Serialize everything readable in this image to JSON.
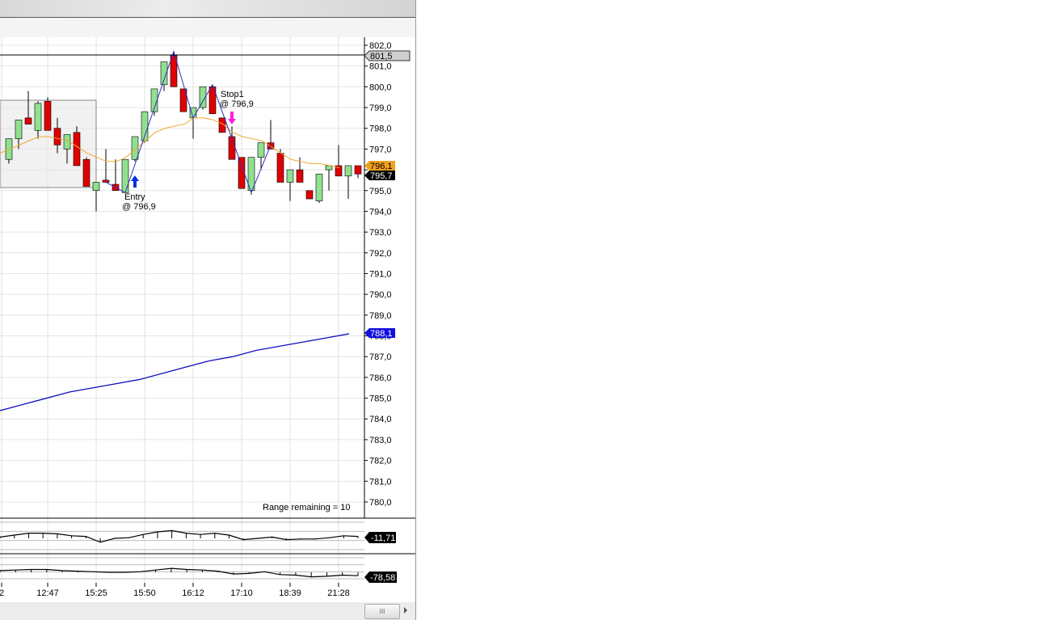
{
  "price_axis": {
    "labels": [
      "802,0",
      "801,0",
      "800,0",
      "799,0",
      "798,0",
      "797,0",
      "796,0",
      "795,0",
      "794,0",
      "793,0",
      "792,0",
      "791,0",
      "790,0",
      "789,0",
      "788,0",
      "787,0",
      "786,0",
      "785,0",
      "784,0",
      "783,0",
      "782,0",
      "781,0",
      "780,0"
    ],
    "max": 802,
    "min": 780
  },
  "time_axis": {
    "labels": [
      "2",
      "12:47",
      "15:25",
      "15:50",
      "16:12",
      "17:10",
      "18:39",
      "21:28"
    ]
  },
  "markers": {
    "high_line": "801,5",
    "ma_value": "796,1",
    "last_price": "795,7",
    "long_ma_value": "788,1",
    "high_price": 801.5,
    "ma_price": 796.1,
    "last": 795.7,
    "long_ma": 788.1
  },
  "annotations": {
    "entry_label": "Entry",
    "entry_price": "@ 796,9",
    "stop_label": "Stop1",
    "stop_price": "@ 796,9",
    "range_text": "Range remaining = 10"
  },
  "indicators": {
    "ind1_value": "-11,71",
    "ind2_value": "-78,58"
  },
  "scrollbar": {
    "thumb_label": "III"
  },
  "colors": {
    "up": "#90e090",
    "down": "#e00000",
    "ma": "#f0a830",
    "long_ma": "#1010c0",
    "zigzag": "#3030c0",
    "entry": "#0030e0",
    "stop": "#ff20e0"
  },
  "candles": [
    [
      796.5,
      797.5,
      796.3,
      797.5
    ],
    [
      797.5,
      798.0,
      797.0,
      798.4
    ],
    [
      798.5,
      799.8,
      798.2,
      798.2
    ],
    [
      797.9,
      799.3,
      797.5,
      799.2
    ],
    [
      799.3,
      799.5,
      797.9,
      797.9
    ],
    [
      798.0,
      798.5,
      796.8,
      797.2
    ],
    [
      797.0,
      797.7,
      796.3,
      797.7
    ],
    [
      797.8,
      798.1,
      796.2,
      796.2
    ],
    [
      796.5,
      796.6,
      795.2,
      795.2
    ],
    [
      795.0,
      795.4,
      794.0,
      795.4
    ],
    [
      795.5,
      797.0,
      795.4,
      795.4
    ],
    [
      795.3,
      796.5,
      795.0,
      795.0
    ],
    [
      794.9,
      796.5,
      794.9,
      796.5
    ],
    [
      796.5,
      797.6,
      796.4,
      797.6
    ],
    [
      797.4,
      798.8,
      797.3,
      798.8
    ],
    [
      798.8,
      799.9,
      798.6,
      799.9
    ],
    [
      800.1,
      801.2,
      799.8,
      801.2
    ],
    [
      801.5,
      801.7,
      800.0,
      800.0
    ],
    [
      799.9,
      799.9,
      798.8,
      798.8
    ],
    [
      798.5,
      799.0,
      797.5,
      799.0
    ],
    [
      799.0,
      800.0,
      798.9,
      800.0
    ],
    [
      800.0,
      800.1,
      798.7,
      798.7
    ],
    [
      798.5,
      798.5,
      797.8,
      797.8
    ],
    [
      797.6,
      798.1,
      796.5,
      796.5
    ],
    [
      796.6,
      796.6,
      795.1,
      795.1
    ],
    [
      795.0,
      796.6,
      794.8,
      796.6
    ],
    [
      796.6,
      797.3,
      796.0,
      797.3
    ],
    [
      797.3,
      798.4,
      797.0,
      797.0
    ],
    [
      796.8,
      797.0,
      795.4,
      795.4
    ],
    [
      795.4,
      796.0,
      794.5,
      796.0
    ],
    [
      796.0,
      796.6,
      795.4,
      795.4
    ],
    [
      795.0,
      795.0,
      794.6,
      794.6
    ],
    [
      794.5,
      795.8,
      794.4,
      795.8
    ],
    [
      796.0,
      796.2,
      795.0,
      796.2
    ],
    [
      796.2,
      797.2,
      795.7,
      795.7
    ],
    [
      795.7,
      796.2,
      794.6,
      796.2
    ],
    [
      796.2,
      796.2,
      795.6,
      795.8
    ]
  ],
  "ma_series": [
    796.8,
    797.0,
    797.2,
    797.4,
    797.6,
    797.6,
    797.5,
    797.4,
    797.1,
    796.8,
    796.6,
    796.4,
    796.4,
    796.6,
    797.0,
    797.4,
    797.8,
    798.0,
    798.1,
    798.2,
    798.5,
    798.5,
    798.4,
    798.2,
    797.8,
    797.6,
    797.5,
    797.4,
    797.1,
    796.8,
    796.5,
    796.4,
    796.3,
    796.3,
    796.2,
    796.1
  ],
  "long_ma_series": [
    784.4,
    784.7,
    785.0,
    785.3,
    785.5,
    785.7,
    785.9,
    786.2,
    786.5,
    786.8,
    787.0,
    787.3,
    787.5,
    787.7,
    787.9,
    788.1
  ],
  "ind1_series": [
    0.2,
    0.5,
    0.8,
    0.8,
    0.7,
    0.4,
    0.3,
    -0.6,
    0.0,
    0.1,
    0.6,
    1.0,
    1.2,
    0.8,
    0.6,
    0.8,
    0.5,
    -0.2,
    0.0,
    0.2,
    -0.2,
    -0.1,
    -0.1,
    0.1,
    0.4,
    0.3
  ],
  "ind2_series": [
    0.3,
    0.4,
    0.5,
    0.5,
    0.3,
    0.2,
    0.1,
    0.0,
    0.0,
    0.1,
    0.4,
    0.7,
    0.5,
    0.4,
    0.2,
    -0.3,
    -0.2,
    0.1,
    -0.4,
    -0.5,
    -0.8,
    -0.7,
    -0.5,
    -0.6
  ]
}
